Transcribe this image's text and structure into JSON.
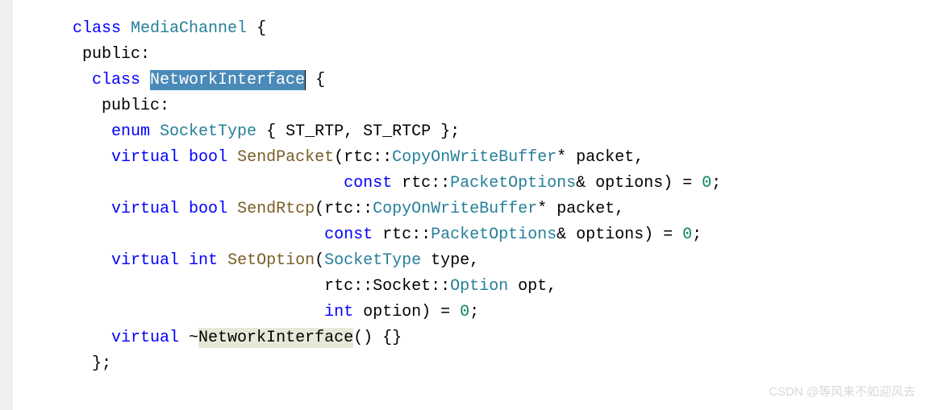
{
  "code": {
    "l1": {
      "kw_class": "class",
      "type_name": "MediaChannel",
      "brace_open": " {"
    },
    "l2": {
      "access": " public:"
    },
    "l3": {
      "kw_class": "  class",
      "type_name_hl": "NetworkInterface",
      "brace_open": " {"
    },
    "l4": {
      "access": "   public:"
    },
    "l5": {
      "kw_enum": "    enum",
      "type_name": "SocketType",
      "body": " { ST_RTP, ST_RTCP };"
    },
    "l6": {
      "kw_virtual": "    virtual",
      "kw_bool": "bool",
      "func": "SendPacket",
      "args_a": "(rtc::",
      "type_a": "CopyOnWriteBuffer",
      "args_b": "* packet,"
    },
    "l7": {
      "indent": "                            ",
      "kw_const": "const",
      "ns": " rtc::",
      "type_a": "PacketOptions",
      "rest": "& options) = ",
      "zero": "0",
      "semi": ";"
    },
    "l8": {
      "kw_virtual": "    virtual",
      "kw_bool": "bool",
      "func": "SendRtcp",
      "args_a": "(rtc::",
      "type_a": "CopyOnWriteBuffer",
      "args_b": "* packet,"
    },
    "l9": {
      "indent": "                          ",
      "kw_const": "const",
      "ns": " rtc::",
      "type_a": "PacketOptions",
      "rest": "& options) = ",
      "zero": "0",
      "semi": ";"
    },
    "l10": {
      "kw_virtual": "    virtual",
      "kw_int": "int",
      "func": "SetOption",
      "args_a": "(",
      "type_a": "SocketType",
      "args_b": " type,"
    },
    "l11": {
      "indent": "                          ",
      "ns": "rtc::Socket::",
      "type_a": "Option",
      "rest": " opt,"
    },
    "l12": {
      "indent": "                          ",
      "kw_int": "int",
      "rest": " option) = ",
      "zero": "0",
      "semi": ";"
    },
    "l13": {
      "kw_virtual": "    virtual",
      "tilde": " ~",
      "type_hl": "NetworkInterface",
      "rest": "() {}"
    },
    "l14": {
      "close": "  };"
    }
  },
  "watermark": "CSDN @等风来不如迎风去"
}
